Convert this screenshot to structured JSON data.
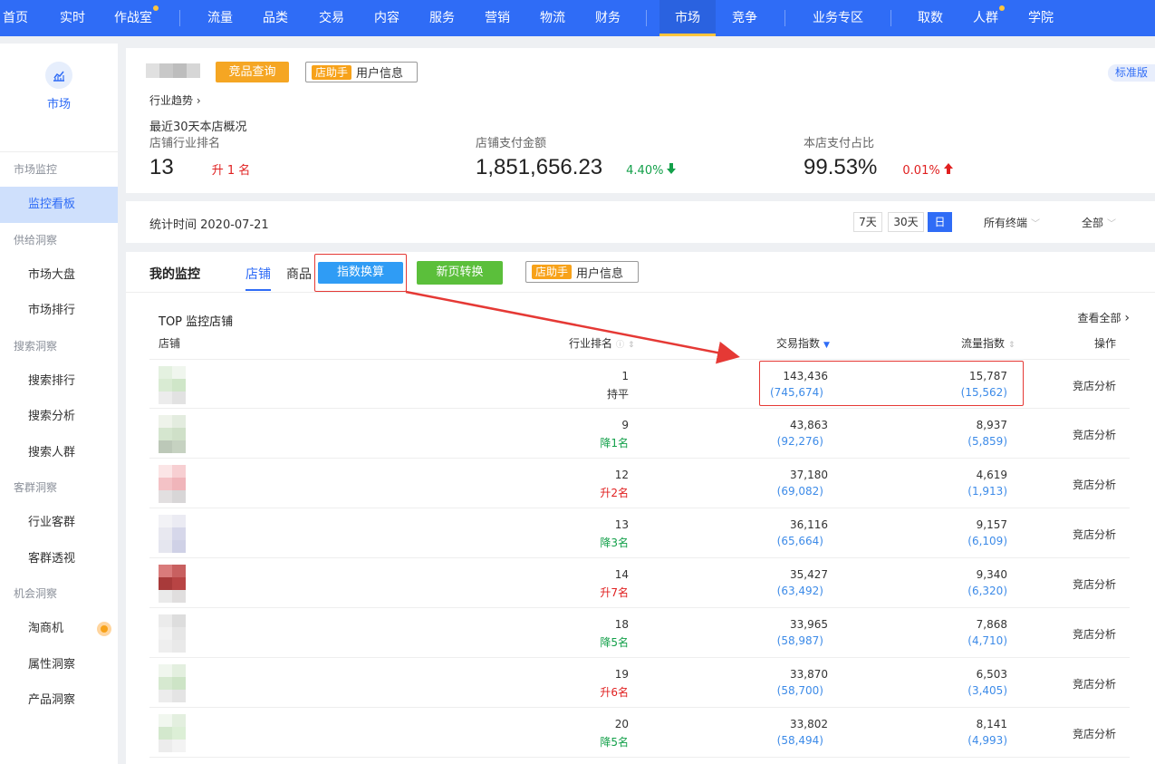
{
  "topnav": {
    "items": [
      {
        "label": "首页"
      },
      {
        "label": "实时"
      },
      {
        "label": "作战室"
      },
      {
        "label": "流量"
      },
      {
        "label": "品类"
      },
      {
        "label": "交易"
      },
      {
        "label": "内容"
      },
      {
        "label": "服务"
      },
      {
        "label": "营销"
      },
      {
        "label": "物流"
      },
      {
        "label": "财务"
      },
      {
        "label": "市场"
      },
      {
        "label": "竞争"
      },
      {
        "label": "业务专区"
      },
      {
        "label": "取数"
      },
      {
        "label": "人群"
      },
      {
        "label": "学院"
      }
    ],
    "active": "市场",
    "colors": {
      "bg": "#2f6cf6",
      "dot": "#ffc53d"
    }
  },
  "sidebar": {
    "head_label": "市场",
    "head_icon": "chart-icon",
    "groups": [
      {
        "title": "市场监控",
        "items": [
          {
            "label": "监控看板",
            "active": true
          }
        ]
      },
      {
        "title": "供给洞察",
        "items": [
          {
            "label": "市场大盘"
          },
          {
            "label": "市场排行"
          }
        ]
      },
      {
        "title": "搜索洞察",
        "items": [
          {
            "label": "搜索排行"
          },
          {
            "label": "搜索分析"
          },
          {
            "label": "搜索人群"
          }
        ]
      },
      {
        "title": "客群洞察",
        "items": [
          {
            "label": "行业客群"
          },
          {
            "label": "客群透视"
          }
        ]
      },
      {
        "title": "机会洞察",
        "items": [
          {
            "label": "淘商机"
          },
          {
            "label": "属性洞察"
          },
          {
            "label": "产品洞察"
          }
        ]
      }
    ]
  },
  "overview": {
    "compete_query_btn": "竞品查询",
    "helper_tag": "店助手",
    "helper_text": "用户信息",
    "edition_badge": "标准版",
    "trend_link": "行业趋势",
    "title": "最近30天本店概况",
    "stats": [
      {
        "label": "店铺行业排名",
        "value": "13",
        "change": "升 1 名"
      },
      {
        "label": "店铺支付金额",
        "value": "1,851,656.23",
        "change": "4.40%"
      },
      {
        "label": "本店支付占比",
        "value": "99.53%",
        "change": "0.01%"
      }
    ]
  },
  "filter": {
    "stat_time": "统计时间 2020-07-21",
    "ranges": [
      "7天",
      "30天",
      "日"
    ],
    "selected_range": "日",
    "terminal": "所有终端",
    "scope": "全部"
  },
  "monitor": {
    "title": "我的监控",
    "tabs": [
      "店铺",
      "商品"
    ],
    "active_tab": "店铺",
    "index_convert_btn": "指数换算",
    "new_page_btn": "新页转换",
    "helper_tag": "店助手",
    "helper_text": "用户信息",
    "table_title": "TOP 监控店铺",
    "view_all": "查看全部",
    "columns": {
      "shop": "店铺",
      "rank": "行业排名",
      "trade": "交易指数",
      "flow": "流量指数",
      "op": "操作"
    },
    "rows": [
      {
        "rank": "1",
        "rank_change": "持平",
        "trend": "flat",
        "trade": "143,436",
        "trade_sub": "(745,674)",
        "flow": "15,787",
        "flow_sub": "(15,562)",
        "op": "竞店分析",
        "thumb": [
          "#e4f1e0",
          "#f0f6ee",
          "#d9ebd3",
          "#cfe6c8",
          "#ececec",
          "#e2e2e2"
        ]
      },
      {
        "rank": "9",
        "rank_change": "降1名",
        "trend": "down",
        "trade": "43,863",
        "trade_sub": "(92,276)",
        "flow": "8,937",
        "flow_sub": "(5,859)",
        "op": "竞店分析",
        "thumb": [
          "#eef3ea",
          "#e3ecdf",
          "#d5e6cf",
          "#cfe0c8",
          "#bcc8b8",
          "#c6d2c1"
        ]
      },
      {
        "rank": "12",
        "rank_change": "升2名",
        "trend": "up",
        "trade": "37,180",
        "trade_sub": "(69,082)",
        "flow": "4,619",
        "flow_sub": "(1,913)",
        "op": "竞店分析",
        "thumb": [
          "#fbe5e6",
          "#f7cfd2",
          "#f4c2c6",
          "#f0b5ba",
          "#e2dfe0",
          "#d8d6d7"
        ]
      },
      {
        "rank": "13",
        "rank_change": "降3名",
        "trend": "down",
        "trade": "36,116",
        "trade_sub": "(65,664)",
        "flow": "9,157",
        "flow_sub": "(6,109)",
        "op": "竞店分析",
        "thumb": [
          "#f2f2f6",
          "#ebebf3",
          "#e8e8f0",
          "#d6d7ea",
          "#e5e6ef",
          "#cfd1e6"
        ]
      },
      {
        "rank": "14",
        "rank_change": "升7名",
        "trend": "up",
        "trade": "35,427",
        "trade_sub": "(63,492)",
        "flow": "9,340",
        "flow_sub": "(6,320)",
        "op": "竞店分析",
        "thumb": [
          "#d97b7b",
          "#c86060",
          "#a83a3a",
          "#b84444",
          "#eaeaea",
          "#e0dede"
        ]
      },
      {
        "rank": "18",
        "rank_change": "降5名",
        "trend": "down",
        "trade": "33,965",
        "trade_sub": "(58,987)",
        "flow": "7,868",
        "flow_sub": "(4,710)",
        "op": "竞店分析",
        "thumb": [
          "#ebebeb",
          "#dddddd",
          "#f2f2f2",
          "#e6e6e6",
          "#eeeeee",
          "#e9e9e9"
        ]
      },
      {
        "rank": "19",
        "rank_change": "升6名",
        "trend": "up",
        "trade": "33,870",
        "trade_sub": "(58,700)",
        "flow": "6,503",
        "flow_sub": "(3,405)",
        "op": "竞店分析",
        "thumb": [
          "#f0f6ee",
          "#e3efdf",
          "#d6e9d0",
          "#cde4c6",
          "#ececec",
          "#e4e4e4"
        ]
      },
      {
        "rank": "20",
        "rank_change": "降5名",
        "trend": "down",
        "trade": "33,802",
        "trade_sub": "(58,494)",
        "flow": "8,141",
        "flow_sub": "(4,993)",
        "op": "竞店分析",
        "thumb": [
          "#f1f7ef",
          "#e3efdf",
          "#d3e8cd",
          "#dcefd6",
          "#ececec",
          "#f3f3f3"
        ]
      }
    ]
  }
}
